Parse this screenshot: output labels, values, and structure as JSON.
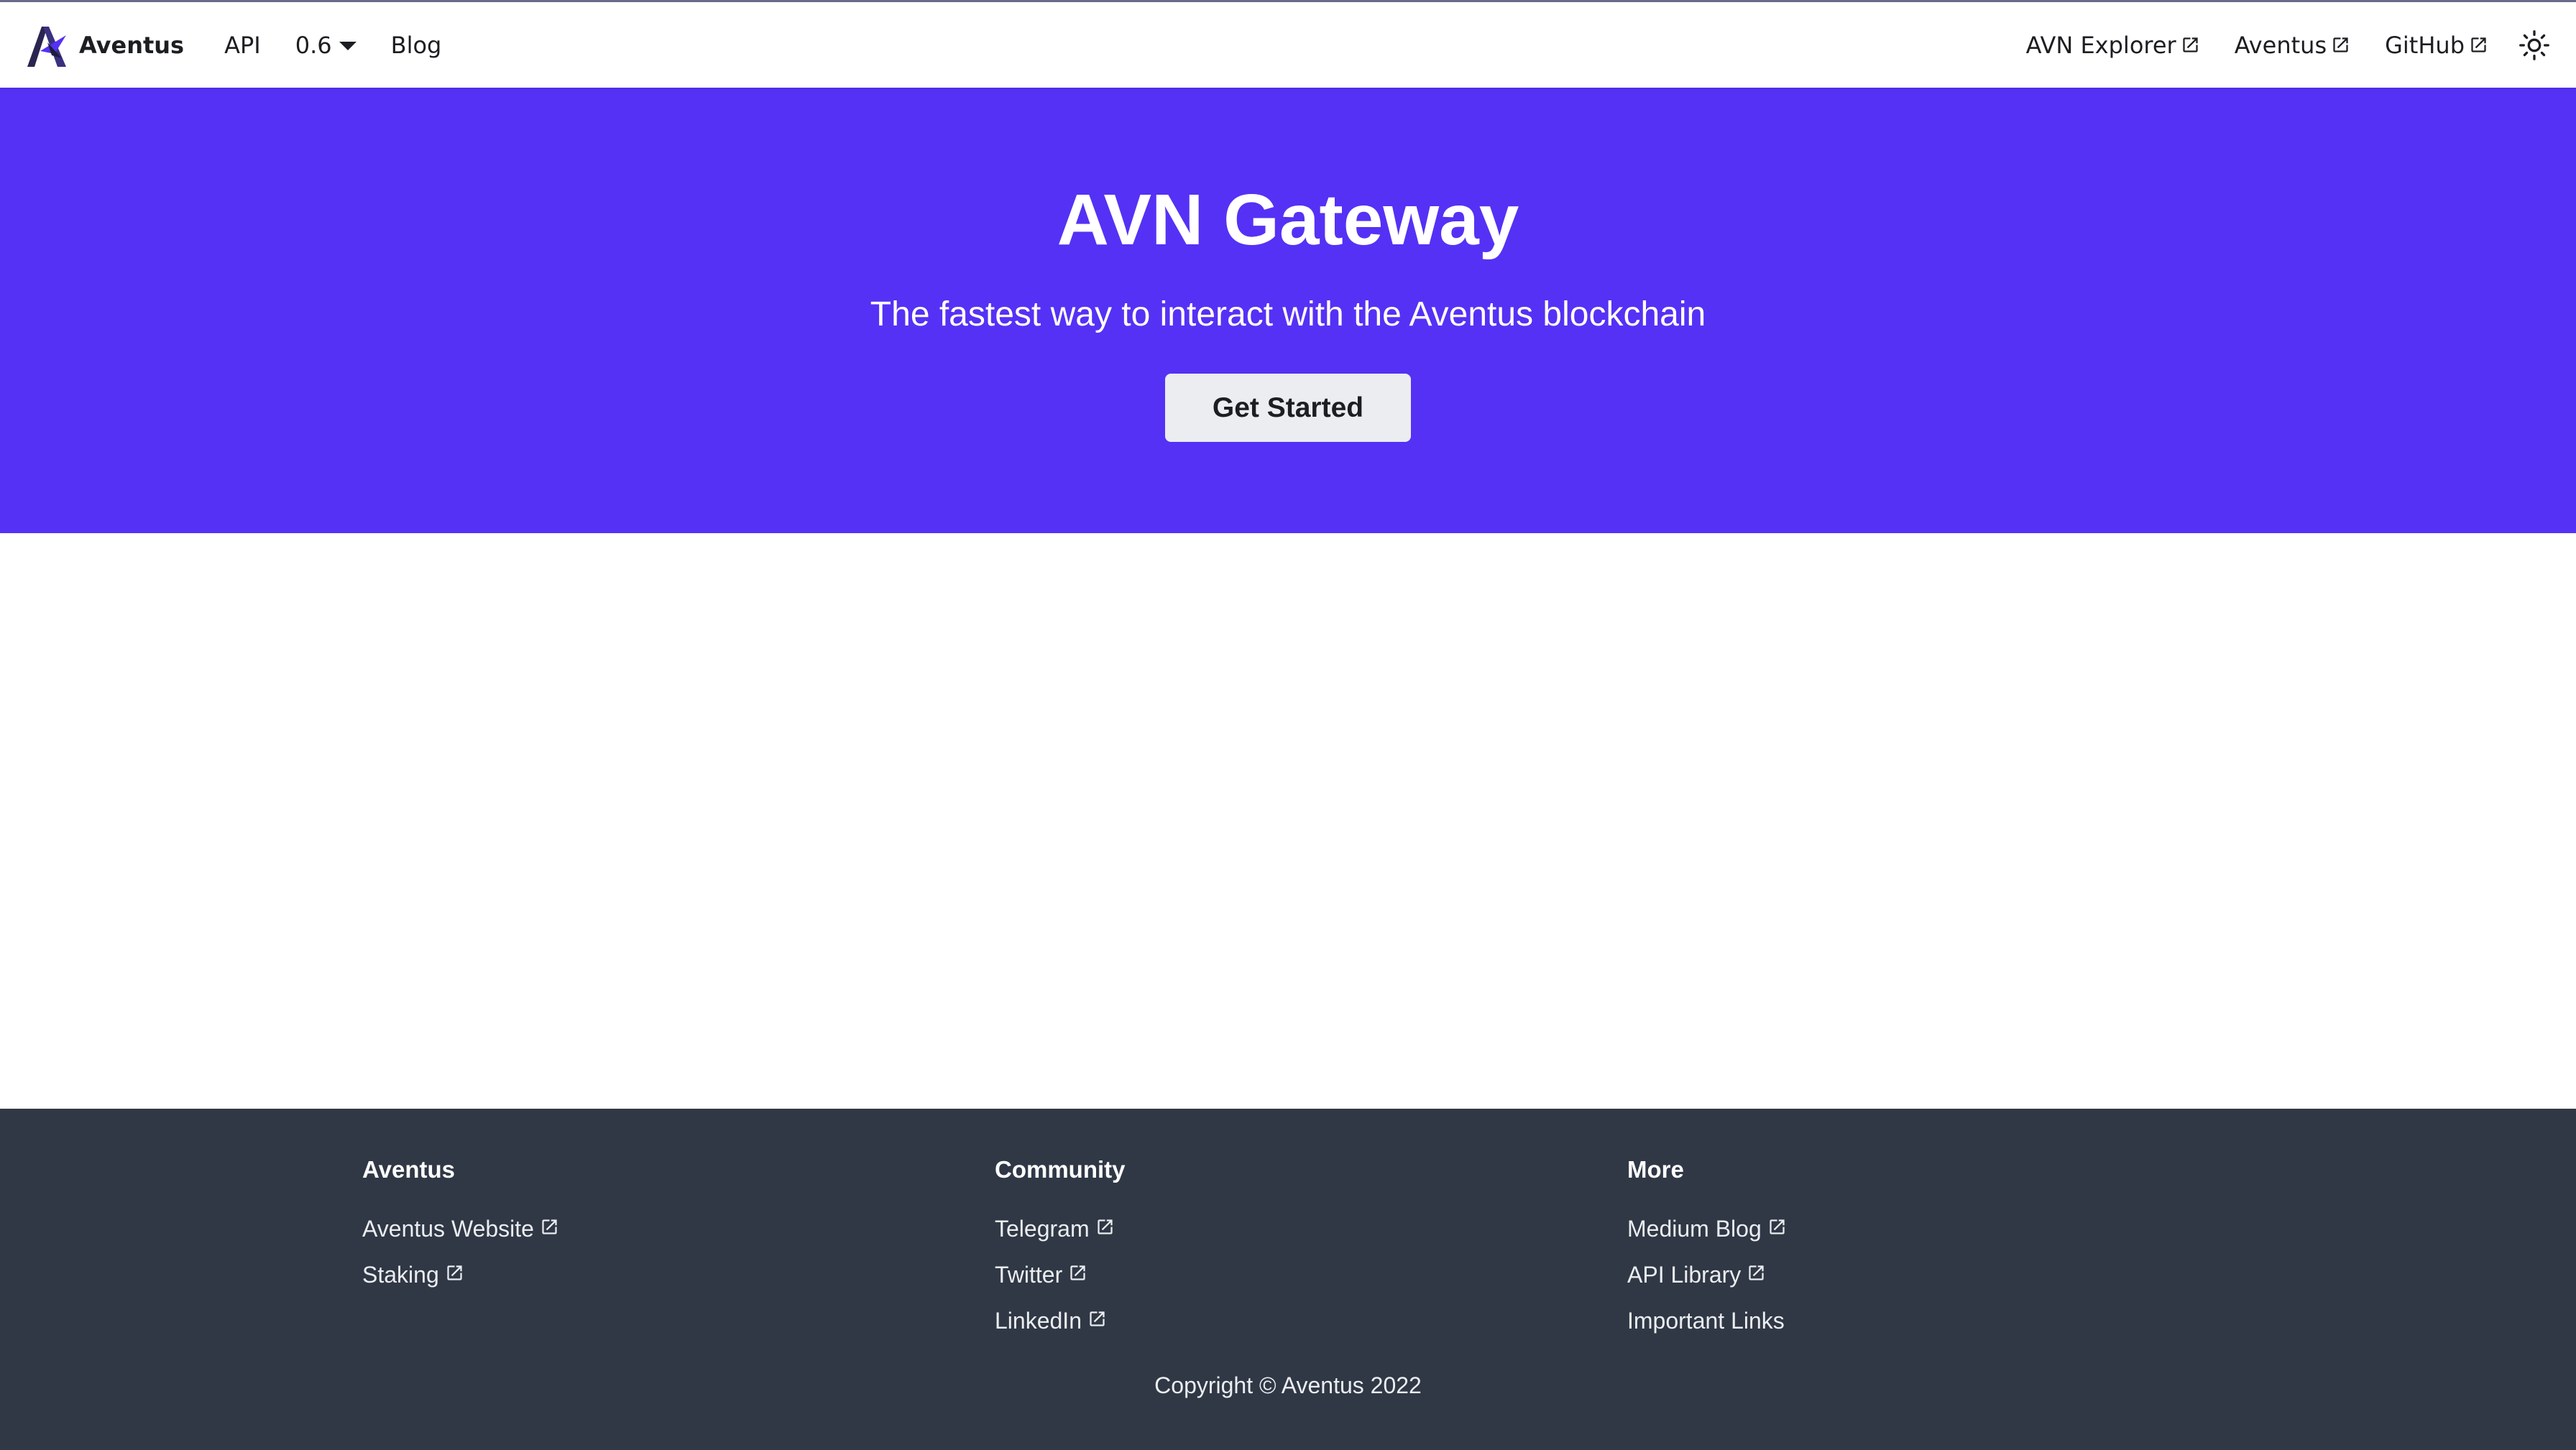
{
  "navbar": {
    "brand_title": "Aventus",
    "left_links": [
      {
        "label": "API"
      },
      {
        "label": "0.6"
      },
      {
        "label": "Blog"
      }
    ],
    "right_links": [
      {
        "label": "AVN Explorer",
        "icon": "external-link-icon"
      },
      {
        "label": "Aventus",
        "icon": "external-link-icon"
      },
      {
        "label": "GitHub",
        "icon": "external-link-icon"
      }
    ],
    "theme_toggle_icon": "sun-icon"
  },
  "hero": {
    "title": "AVN Gateway",
    "subtitle": "The fastest way to interact with the Aventus blockchain",
    "cta_label": "Get Started",
    "background_color": "#5531f5"
  },
  "footer": {
    "background_color": "#303846",
    "columns": [
      {
        "title": "Aventus",
        "links": [
          {
            "label": "Aventus Website",
            "external": true
          },
          {
            "label": "Staking",
            "external": true
          }
        ]
      },
      {
        "title": "Community",
        "links": [
          {
            "label": "Telegram",
            "external": true
          },
          {
            "label": "Twitter",
            "external": true
          },
          {
            "label": "LinkedIn",
            "external": true
          }
        ]
      },
      {
        "title": "More",
        "links": [
          {
            "label": "Medium Blog",
            "external": true
          },
          {
            "label": "API Library",
            "external": true
          },
          {
            "label": "Important Links",
            "external": false
          }
        ]
      }
    ],
    "copyright": "Copyright © Aventus 2022"
  }
}
